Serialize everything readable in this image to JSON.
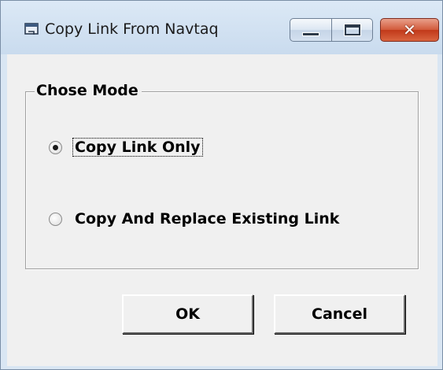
{
  "window": {
    "title": "Copy Link From Navtaq",
    "icon": "app-window-icon",
    "controls": {
      "minimize_icon": "minimize-icon",
      "maximize_icon": "maximize-icon",
      "close_icon": "close-icon"
    },
    "close_glyph": "✕"
  },
  "group": {
    "label": "Chose Mode",
    "options": [
      {
        "label": "Copy Link Only",
        "selected": true
      },
      {
        "label": "Copy And Replace Existing Link",
        "selected": false
      }
    ]
  },
  "buttons": {
    "ok_label": "OK",
    "cancel_label": "Cancel"
  },
  "colors": {
    "dialog_bg": "#f0f0f0",
    "titlebar": "#c9dbee",
    "close_button": "#c1391a"
  }
}
